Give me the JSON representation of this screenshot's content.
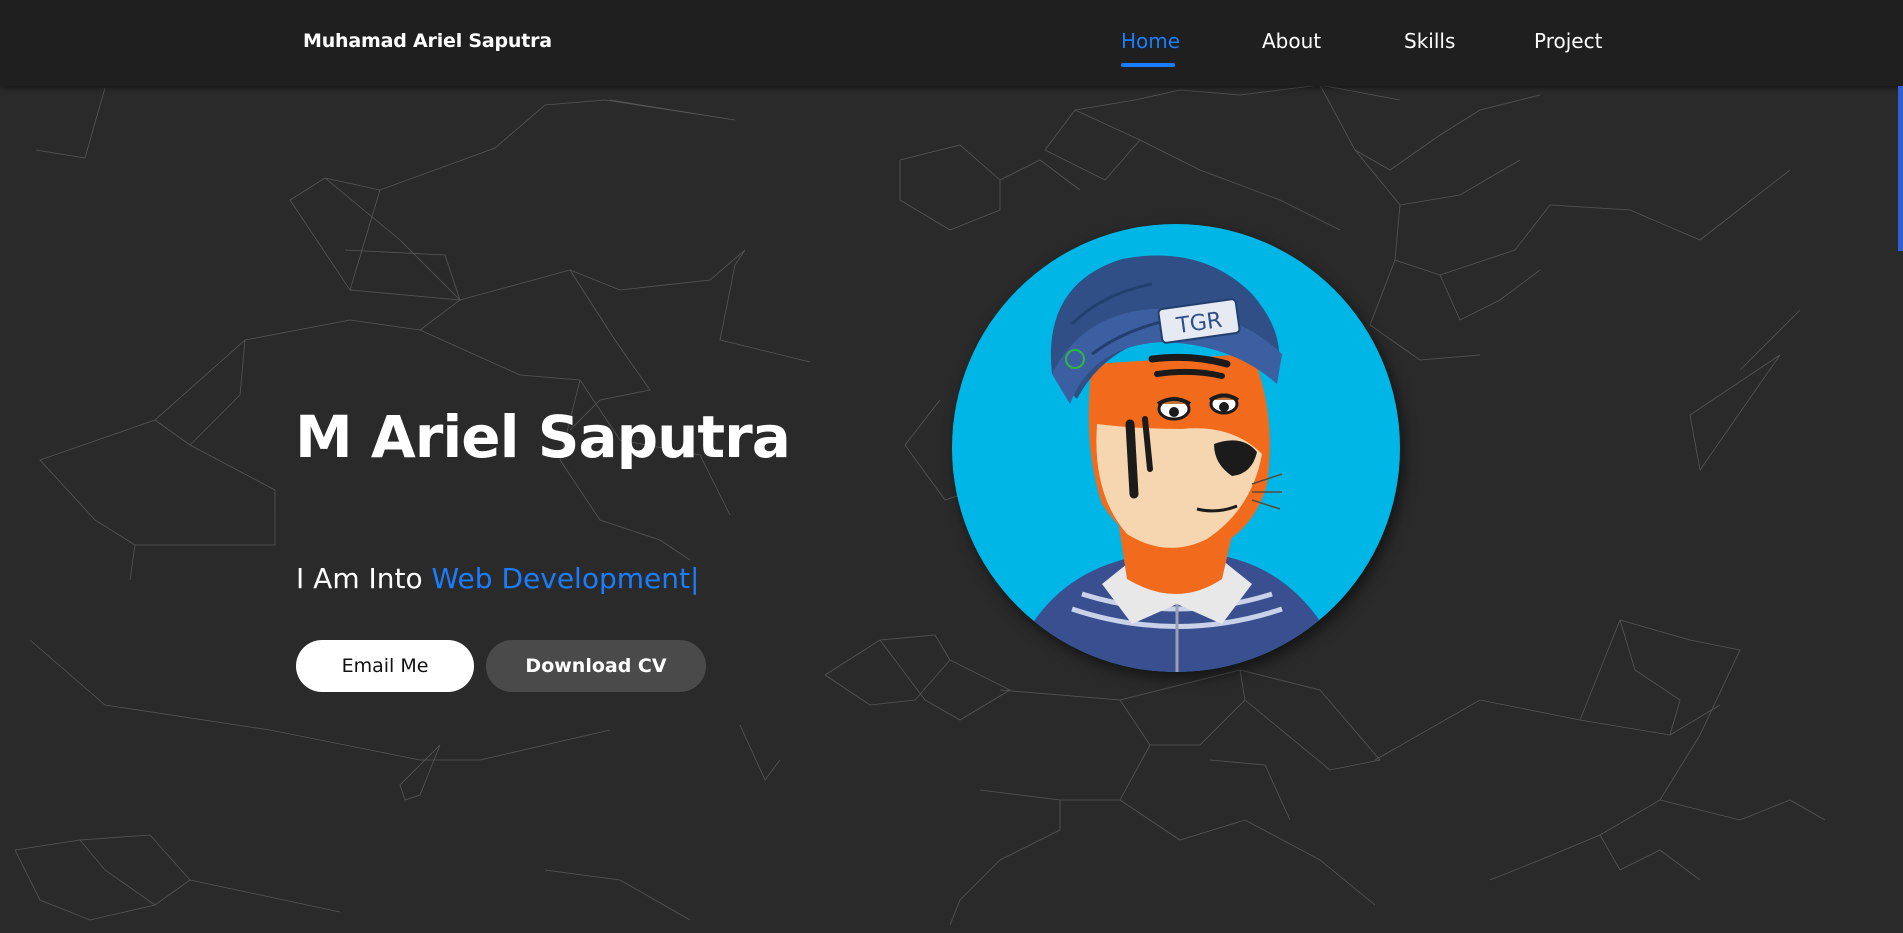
{
  "navbar": {
    "brand": "Muhamad Ariel Saputra",
    "items": [
      {
        "label": "Home",
        "active": true
      },
      {
        "label": "About",
        "active": false
      },
      {
        "label": "Skills",
        "active": false
      },
      {
        "label": "Project",
        "active": false
      }
    ]
  },
  "hero": {
    "name": "M Ariel Saputra",
    "subtitle_prefix": "I Am Into ",
    "subtitle_accent": "Web Development|",
    "email_button": "Email Me",
    "cv_button": "Download CV",
    "avatar_cap_text": "TGR"
  },
  "colors": {
    "accent": "#1a7dfd",
    "background": "#2a2a2a",
    "navbar": "#1f1f1f",
    "avatar_bg": "#00b6e6"
  }
}
